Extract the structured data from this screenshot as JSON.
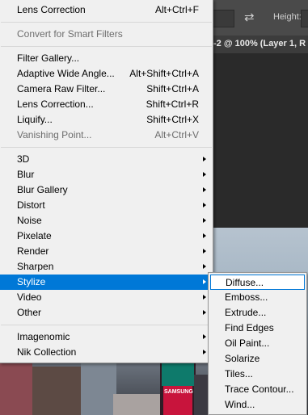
{
  "background": {
    "options_bar": {
      "height_label": "Height:",
      "swap_icon": "swap-arrows-icon"
    },
    "document_tab": {
      "title": "-2 @ 100% (Layer 1, R"
    },
    "billboard_text": "SAMSUNG"
  },
  "filter_menu": {
    "last_filter": {
      "label": "Lens Correction",
      "shortcut": "Alt+Ctrl+F"
    },
    "convert_smart": {
      "label": "Convert for Smart Filters"
    },
    "items": [
      {
        "label": "Filter Gallery...",
        "shortcut": ""
      },
      {
        "label": "Adaptive Wide Angle...",
        "shortcut": "Alt+Shift+Ctrl+A"
      },
      {
        "label": "Camera Raw Filter...",
        "shortcut": "Shift+Ctrl+A"
      },
      {
        "label": "Lens Correction...",
        "shortcut": "Shift+Ctrl+R"
      },
      {
        "label": "Liquify...",
        "shortcut": "Shift+Ctrl+X"
      },
      {
        "label": "Vanishing Point...",
        "shortcut": "Alt+Ctrl+V"
      }
    ],
    "categories": [
      {
        "label": "3D"
      },
      {
        "label": "Blur"
      },
      {
        "label": "Blur Gallery"
      },
      {
        "label": "Distort"
      },
      {
        "label": "Noise"
      },
      {
        "label": "Pixelate"
      },
      {
        "label": "Render"
      },
      {
        "label": "Sharpen"
      },
      {
        "label": "Stylize"
      },
      {
        "label": "Video"
      },
      {
        "label": "Other"
      }
    ],
    "plugins": [
      {
        "label": "Imagenomic"
      },
      {
        "label": "Nik Collection"
      }
    ]
  },
  "stylize_submenu": {
    "items": [
      {
        "label": "Diffuse..."
      },
      {
        "label": "Emboss..."
      },
      {
        "label": "Extrude..."
      },
      {
        "label": "Find Edges"
      },
      {
        "label": "Oil Paint..."
      },
      {
        "label": "Solarize"
      },
      {
        "label": "Tiles..."
      },
      {
        "label": "Trace Contour..."
      },
      {
        "label": "Wind..."
      }
    ]
  },
  "colors": {
    "highlight": "#0078d7",
    "menu_bg": "#f0f0f0",
    "disabled_text": "#6d6d6d"
  }
}
